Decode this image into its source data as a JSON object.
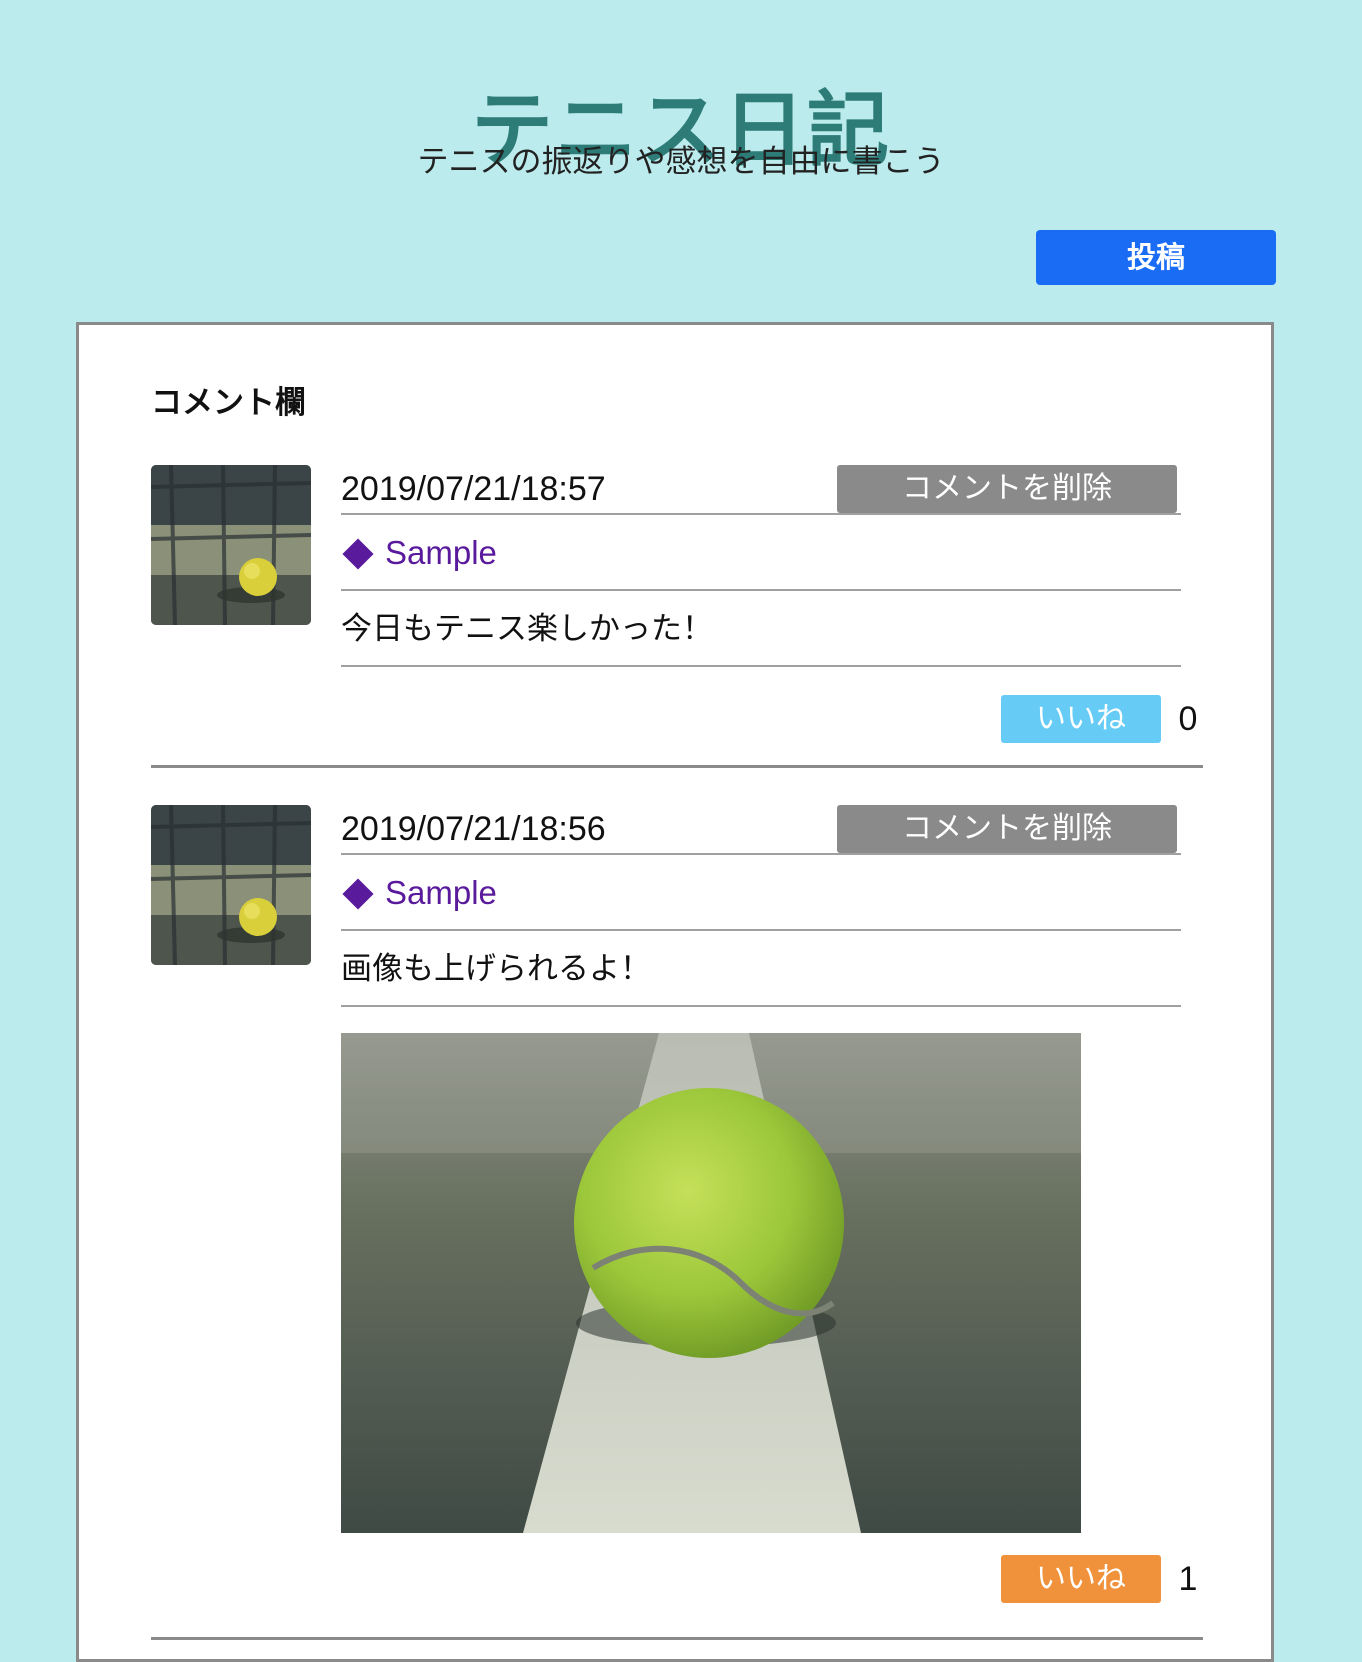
{
  "header": {
    "title": "テニス日記",
    "subtitle": "テニスの振返りや感想を自由に書こう",
    "post_button_label": "投稿"
  },
  "panel": {
    "heading": "コメント欄"
  },
  "comments": [
    {
      "timestamp": "2019/07/21/18:57",
      "delete_label": "コメントを削除",
      "user_name": "Sample",
      "text": "今日もテニス楽しかった！",
      "has_photo": false,
      "like_label": "いいね",
      "like_count": "0",
      "liked": false
    },
    {
      "timestamp": "2019/07/21/18:56",
      "delete_label": "コメントを削除",
      "user_name": "Sample",
      "text": "画像も上げられるよ！",
      "has_photo": true,
      "like_label": "いいね",
      "like_count": "1",
      "liked": true
    }
  ],
  "colors": {
    "page_background": "#bcebed",
    "title": "#2d7c78",
    "post_button": "#1a6cf5",
    "delete_button": "#8a8a8a",
    "user_link": "#5a1a9c",
    "like_inactive": "#66ccf5",
    "like_active": "#f0923c"
  },
  "icons": {
    "user_marker": "diamond-icon"
  }
}
